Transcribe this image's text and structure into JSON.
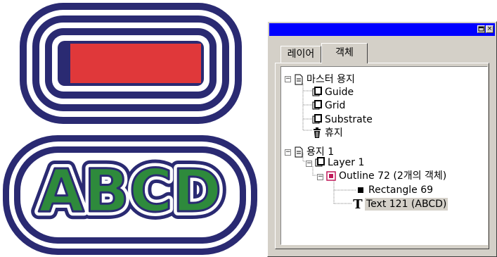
{
  "colors": {
    "outline_navy": "#2a2a72",
    "rect_fill": "#e0383a",
    "text_fill": "#2e8a3c",
    "titlebar": "#0000ff",
    "panel_bg": "#d4d0c8",
    "selection_bg": "#d4d0c8"
  },
  "artwork": {
    "text": "ABCD"
  },
  "docker": {
    "title_buttons": {
      "options_icon": "options-icon",
      "close_icon": "close-icon",
      "close_glyph": "×"
    },
    "tabs": [
      {
        "label": "레이어",
        "active": false
      },
      {
        "label": "객체",
        "active": true
      }
    ],
    "tree": [
      {
        "label": "마스터 용지",
        "icon": "page-icon",
        "expanded": true
      },
      {
        "label": "Guide",
        "icon": "layer-icon"
      },
      {
        "label": "Grid",
        "icon": "layer-icon"
      },
      {
        "label": "Substrate",
        "icon": "layer-icon"
      },
      {
        "label": "휴지",
        "icon": "trash-icon"
      },
      {
        "label": "용지 1",
        "icon": "page-icon",
        "expanded": true
      },
      {
        "label": "Layer 1",
        "icon": "layer-icon",
        "expanded": true
      },
      {
        "label": "Outline 72 (2개의 객체)",
        "icon": "group-icon",
        "expanded": true
      },
      {
        "label": "Rectangle 69",
        "icon": "rectangle-icon"
      },
      {
        "label": "Text 121 (ABCD)",
        "icon": "text-icon",
        "selected": true
      }
    ]
  }
}
